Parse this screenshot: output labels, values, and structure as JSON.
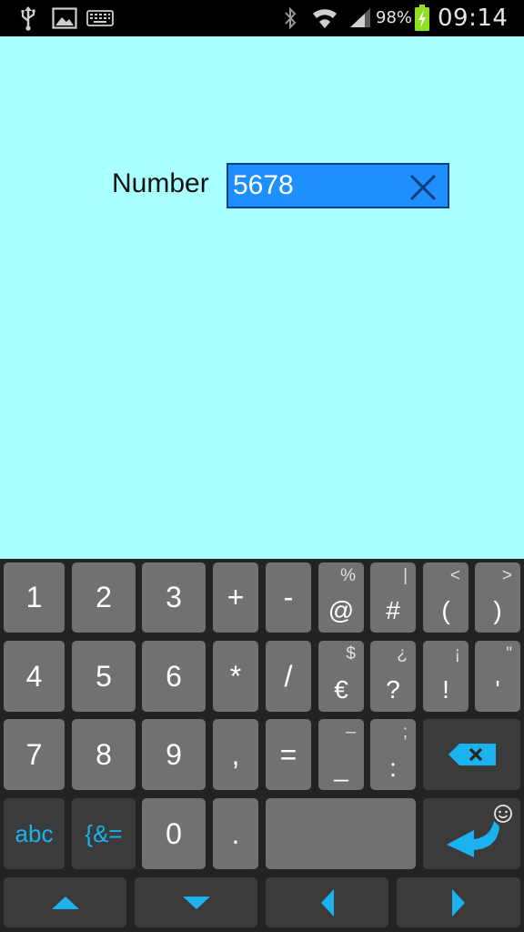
{
  "status_bar": {
    "battery_percent": "98%",
    "time": "09:14",
    "icons": [
      "usb-icon",
      "image-icon",
      "keyboard-icon",
      "bluetooth-icon",
      "wifi-icon",
      "signal-icon",
      "battery-charging-icon"
    ]
  },
  "form": {
    "label": "Number",
    "value": "5678"
  },
  "keyboard": {
    "row1": [
      {
        "main": "1"
      },
      {
        "main": "2"
      },
      {
        "main": "3"
      },
      {
        "main": "+"
      },
      {
        "main": "-"
      },
      {
        "main": "@",
        "sub": "%"
      },
      {
        "main": "#",
        "sub": "|"
      },
      {
        "main": "(",
        "sub": "<"
      },
      {
        "main": ")",
        "sub": ">"
      }
    ],
    "row2": [
      {
        "main": "4"
      },
      {
        "main": "5"
      },
      {
        "main": "6"
      },
      {
        "main": "*"
      },
      {
        "main": "/"
      },
      {
        "main": "€",
        "sub": "$"
      },
      {
        "main": "?",
        "sub": "¿"
      },
      {
        "main": "!",
        "sub": "¡"
      },
      {
        "main": "'",
        "sub": "\""
      }
    ],
    "row3": [
      {
        "main": "7"
      },
      {
        "main": "8"
      },
      {
        "main": "9"
      },
      {
        "main": ","
      },
      {
        "main": "="
      },
      {
        "main": "_",
        "sub": "–"
      },
      {
        "main": ":",
        "sub": ";"
      }
    ],
    "row4": [
      {
        "main": "abc"
      },
      {
        "main": "{&="
      },
      {
        "main": "0"
      },
      {
        "main": "."
      }
    ],
    "accent_color": "#1bb2f0"
  }
}
